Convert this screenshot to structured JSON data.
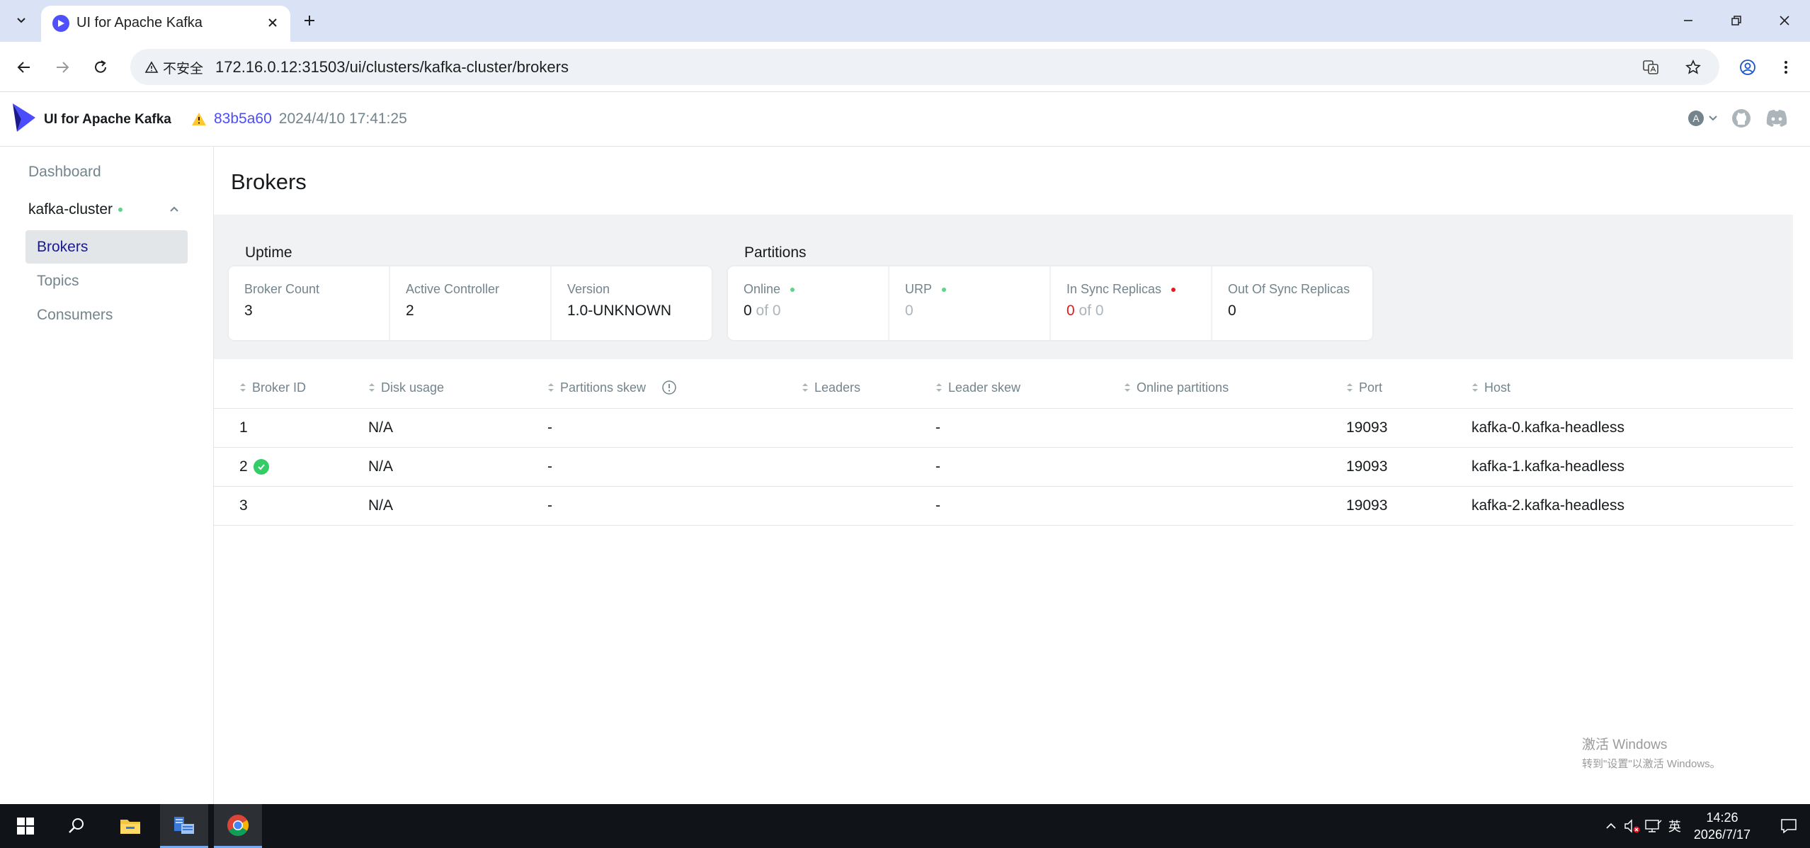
{
  "browser": {
    "tab_title": "UI for Apache Kafka",
    "security_label": "不安全",
    "url": "172.16.0.12:31503/ui/clusters/kafka-cluster/brokers"
  },
  "app": {
    "title": "UI for Apache Kafka",
    "version_hash": "83b5a60",
    "version_date": "2024/4/10 17:41:25",
    "user_initial": "A"
  },
  "sidebar": {
    "dashboard": "Dashboard",
    "cluster_name": "kafka-cluster",
    "items": [
      {
        "label": "Brokers",
        "active": true
      },
      {
        "label": "Topics",
        "active": false
      },
      {
        "label": "Consumers",
        "active": false
      }
    ]
  },
  "page": {
    "title": "Brokers"
  },
  "metrics": {
    "uptime_label": "Uptime",
    "partitions_label": "Partitions",
    "uptime_cards": [
      {
        "label": "Broker Count",
        "value": "3"
      },
      {
        "label": "Active Controller",
        "value": "2"
      },
      {
        "label": "Version",
        "value": "1.0-UNKNOWN"
      }
    ],
    "partition_cards": {
      "online": {
        "label": "Online",
        "value": "0",
        "of": "of 0"
      },
      "urp": {
        "label": "URP",
        "value": "0"
      },
      "in_sync": {
        "label": "In Sync Replicas",
        "value": "0",
        "of": "of 0"
      },
      "out_of_sync": {
        "label": "Out Of Sync Replicas",
        "value": "0"
      }
    }
  },
  "table": {
    "columns": [
      "Broker ID",
      "Disk usage",
      "Partitions skew",
      "Leaders",
      "Leader skew",
      "Online partitions",
      "Port",
      "Host"
    ],
    "rows": [
      {
        "id": "1",
        "disk": "N/A",
        "pskew": "-",
        "leaders": "",
        "lskew": "-",
        "online": "",
        "port": "19093",
        "host": "kafka-0.kafka-headless",
        "controller": false
      },
      {
        "id": "2",
        "disk": "N/A",
        "pskew": "-",
        "leaders": "",
        "lskew": "-",
        "online": "",
        "port": "19093",
        "host": "kafka-1.kafka-headless",
        "controller": true
      },
      {
        "id": "3",
        "disk": "N/A",
        "pskew": "-",
        "leaders": "",
        "lskew": "-",
        "online": "",
        "port": "19093",
        "host": "kafka-2.kafka-headless",
        "controller": false
      }
    ]
  },
  "watermark": {
    "title": "激活 Windows",
    "subtitle": "转到\"设置\"以激活 Windows。"
  },
  "taskbar": {
    "ime": "英",
    "time": "14:26",
    "date": "2026/7/17"
  }
}
